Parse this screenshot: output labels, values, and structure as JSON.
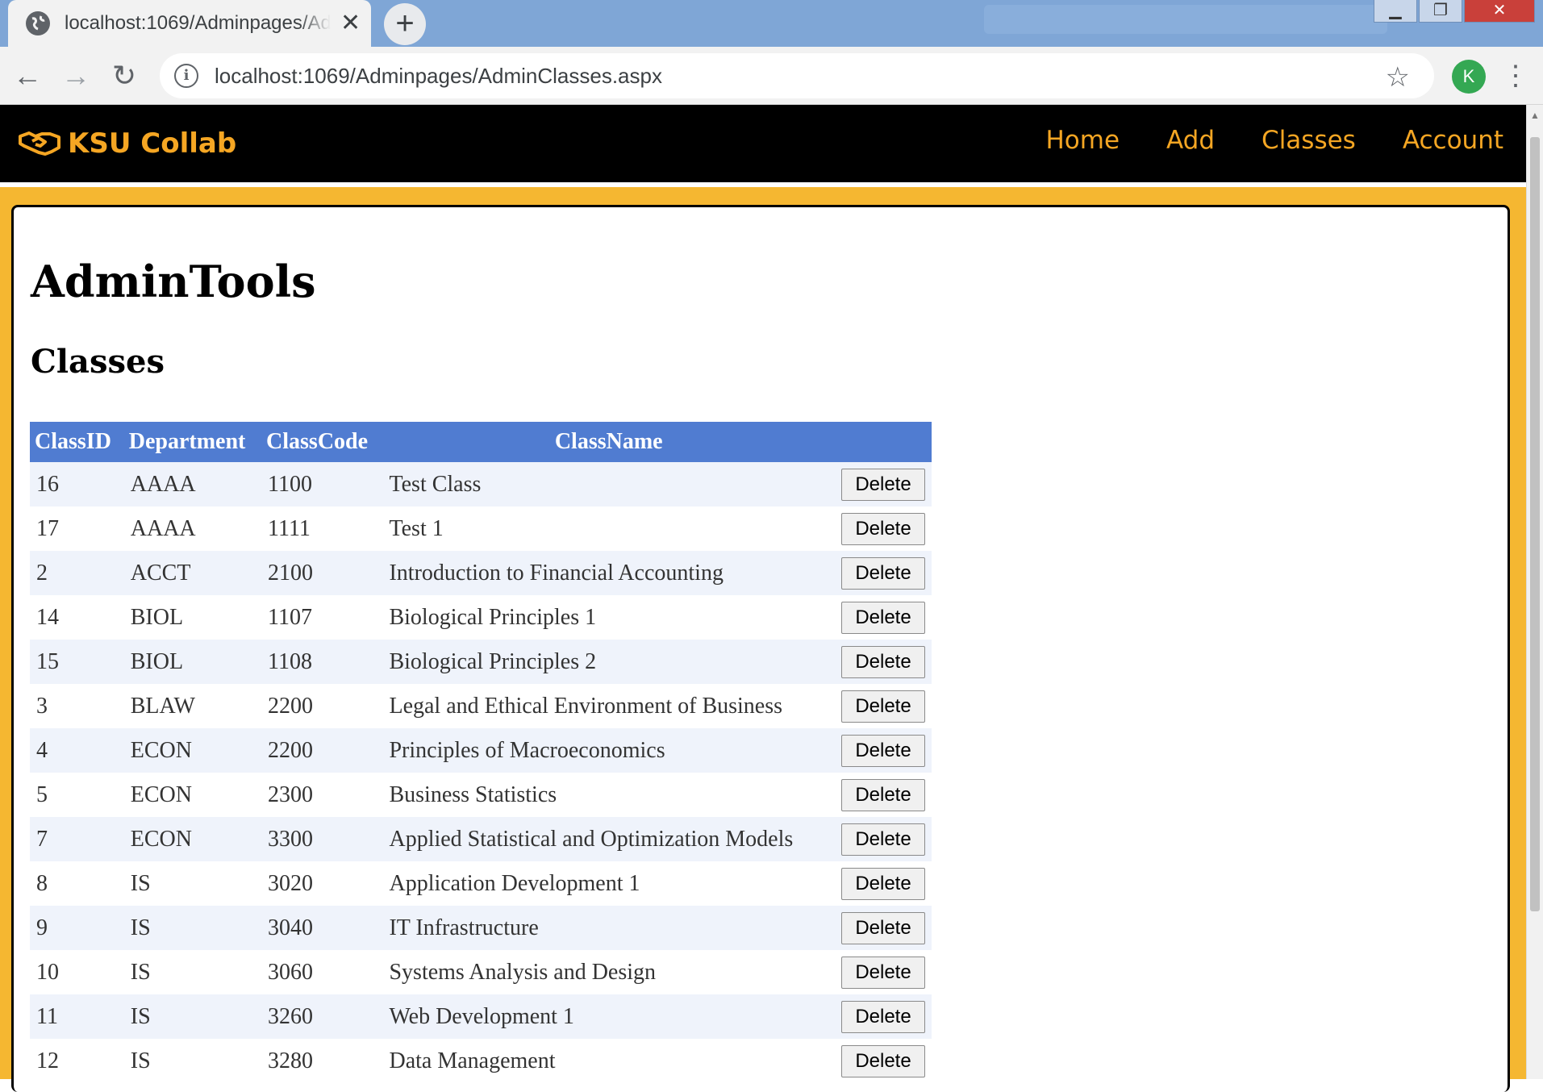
{
  "browser": {
    "tab_title": "localhost:1069/Adminpages/AdminClasses.aspx",
    "tab_close": "✕",
    "new_tab": "+",
    "url": "localhost:1069/Adminpages/AdminClasses.aspx",
    "profile_initial": "K"
  },
  "site": {
    "brand": "KSU Collab",
    "nav": [
      "Home",
      "Add",
      "Classes",
      "Account"
    ],
    "accent_color": "#f5a623"
  },
  "page": {
    "title": "AdminTools",
    "section": "Classes"
  },
  "table": {
    "headers": {
      "class_id": "ClassID",
      "department": "Department",
      "class_code": "ClassCode",
      "class_name": "ClassName"
    },
    "delete_label": "Delete",
    "header_color": "#507cd1",
    "rows": [
      {
        "id": "16",
        "dept": "AAAA",
        "code": "1100",
        "name": "Test Class"
      },
      {
        "id": "17",
        "dept": "AAAA",
        "code": "1111",
        "name": "Test 1"
      },
      {
        "id": "2",
        "dept": "ACCT",
        "code": "2100",
        "name": "Introduction to Financial Accounting"
      },
      {
        "id": "14",
        "dept": "BIOL",
        "code": "1107",
        "name": "Biological Principles 1"
      },
      {
        "id": "15",
        "dept": "BIOL",
        "code": "1108",
        "name": "Biological Principles 2"
      },
      {
        "id": "3",
        "dept": "BLAW",
        "code": "2200",
        "name": "Legal and Ethical Environment of Business"
      },
      {
        "id": "4",
        "dept": "ECON",
        "code": "2200",
        "name": "Principles of Macroeconomics"
      },
      {
        "id": "5",
        "dept": "ECON",
        "code": "2300",
        "name": "Business Statistics"
      },
      {
        "id": "7",
        "dept": "ECON",
        "code": "3300",
        "name": "Applied Statistical and Optimization Models"
      },
      {
        "id": "8",
        "dept": "IS",
        "code": "3020",
        "name": "Application Development 1"
      },
      {
        "id": "9",
        "dept": "IS",
        "code": "3040",
        "name": "IT Infrastructure"
      },
      {
        "id": "10",
        "dept": "IS",
        "code": "3060",
        "name": "Systems Analysis and Design"
      },
      {
        "id": "11",
        "dept": "IS",
        "code": "3260",
        "name": "Web Development 1"
      },
      {
        "id": "12",
        "dept": "IS",
        "code": "3280",
        "name": "Data Management"
      }
    ]
  }
}
